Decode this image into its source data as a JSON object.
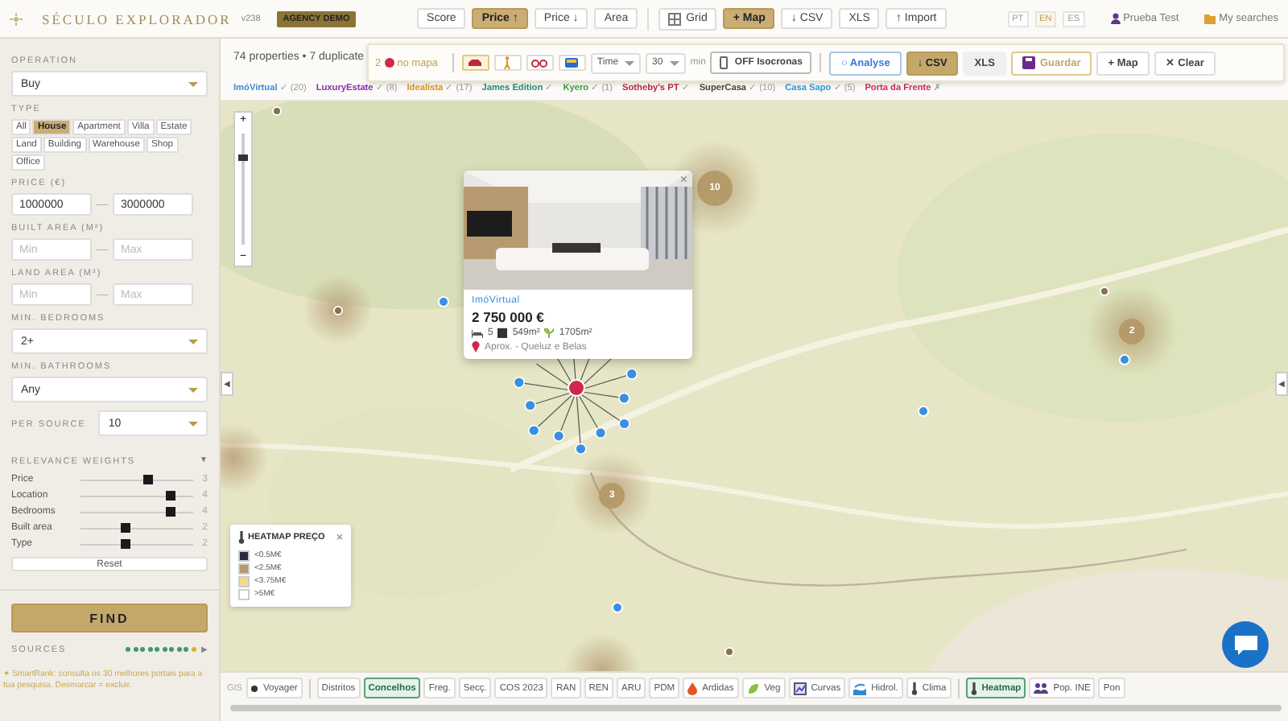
{
  "header": {
    "brand": "SÉCULO EXPLORADOR",
    "version": "v238",
    "badge": "AGENCY DEMO",
    "sort_buttons": [
      {
        "label": "Score",
        "selected": false
      },
      {
        "label": "Price ↑",
        "selected": true
      },
      {
        "label": "Price ↓",
        "selected": false
      },
      {
        "label": "Area",
        "selected": false
      }
    ],
    "view_buttons": [
      {
        "label": "Grid",
        "kind": "grid",
        "selected": false
      },
      {
        "label": "+ Map",
        "kind": "map",
        "selected": true
      }
    ],
    "export_buttons": [
      "↓ CSV",
      "XLS",
      "↑ Import"
    ],
    "languages": [
      {
        "label": "PT",
        "selected": false
      },
      {
        "label": "EN",
        "selected": true
      },
      {
        "label": "ES",
        "selected": false
      }
    ],
    "user": "Prueba Test",
    "saved_searches": "My searches"
  },
  "sidebar": {
    "operation": {
      "label": "OPERATION",
      "value": "Buy"
    },
    "type": {
      "label": "TYPE",
      "options": [
        {
          "label": "All",
          "selected": false
        },
        {
          "label": "House",
          "selected": true
        },
        {
          "label": "Apartment",
          "selected": false
        },
        {
          "label": "Villa",
          "selected": false
        },
        {
          "label": "Estate",
          "selected": false
        },
        {
          "label": "Land",
          "selected": false
        },
        {
          "label": "Building",
          "selected": false
        },
        {
          "label": "Warehouse",
          "selected": false
        },
        {
          "label": "Shop",
          "selected": false
        },
        {
          "label": "Office",
          "selected": false
        }
      ]
    },
    "ranges": [
      {
        "label": "PRICE (€)",
        "min": {
          "value": "1000000"
        },
        "max": {
          "value": "3000000"
        },
        "separator": "—"
      },
      {
        "label": "BUILT AREA (M²)",
        "min": {
          "placeholder": "Min"
        },
        "max": {
          "placeholder": "Max"
        },
        "separator": "—"
      },
      {
        "label": "LAND AREA (M²)",
        "min": {
          "placeholder": "Min"
        },
        "max": {
          "placeholder": "Max"
        },
        "separator": "—"
      }
    ],
    "selects": [
      {
        "label": "MIN. BEDROOMS",
        "value": "2+"
      },
      {
        "label": "MIN. BATHROOMS",
        "value": "Any"
      }
    ],
    "per_source": {
      "label": "PER SOURCE",
      "value": "10"
    },
    "weights": {
      "label": "RELEVANCE WEIGHTS",
      "toggle": "▼",
      "items": [
        {
          "name": "Price",
          "level": 0.6,
          "reading": "3"
        },
        {
          "name": "Location",
          "level": 0.8,
          "reading": "4"
        },
        {
          "name": "Bedrooms",
          "level": 0.8,
          "reading": "4"
        },
        {
          "name": "Built area",
          "level": 0.4,
          "reading": "2"
        },
        {
          "name": "Type",
          "level": 0.4,
          "reading": "2"
        }
      ],
      "reset": "Reset"
    },
    "find": "FIND",
    "sources": {
      "label": "SOURCES",
      "arrow": "▶",
      "dots": [
        {
          "color": "#3f9a6b"
        },
        {
          "color": "#3f9a6b"
        },
        {
          "color": "#3f9a6b"
        },
        {
          "color": "#3f9a6b"
        },
        {
          "color": "#3f9a6b"
        },
        {
          "color": "#3f9a6b"
        },
        {
          "color": "#3f9a6b"
        },
        {
          "color": "#3f9a6b"
        },
        {
          "color": "#3f9a6b"
        },
        {
          "color": "#e0b030"
        }
      ]
    },
    "note": "✦ SmartRank: consulta os 30 melhores portais para a tua pesquisa. Desmarcar = excluir."
  },
  "results": {
    "summary": "74 properties • 7 duplicate",
    "sources": [
      {
        "name": "ImóVirtual",
        "mark": "✓",
        "count": "(20)",
        "color": "#3a8fd8"
      },
      {
        "name": "LuxuryEstate",
        "mark": "✓",
        "count": "(8)",
        "color": "#8a2fb0"
      },
      {
        "name": "Idealista",
        "mark": "✓",
        "count": "(17)",
        "color": "#e0901a"
      },
      {
        "name": "James Edition",
        "mark": "✓",
        "color": "#2a8a70"
      },
      {
        "name": "Kyero",
        "mark": "✓",
        "count": "(1)",
        "color": "#3aa040"
      },
      {
        "name": "Sotheby's PT",
        "mark": "✓",
        "color": "#c0283a"
      },
      {
        "name": "SuperCasa",
        "mark": "✓",
        "count": "(10)",
        "color": "#4a4030"
      },
      {
        "name": "Casa Sapo",
        "mark": "✓",
        "count": "(5)",
        "color": "#2a9ad8"
      },
      {
        "name": "Porta da Frente",
        "mark": "✗",
        "color": "#d0285a"
      }
    ]
  },
  "map_toolbar": {
    "count": "2",
    "count_label": "no mapa",
    "modes": [
      {
        "kind": "car",
        "selected": true
      },
      {
        "kind": "walk",
        "selected": false
      },
      {
        "kind": "bike",
        "selected": false
      },
      {
        "kind": "transit",
        "selected": false
      }
    ],
    "metric": "Time",
    "minutes": "30",
    "unit": "min",
    "isochrone": {
      "state": "OFF",
      "label": "Isocronas"
    },
    "actions": [
      {
        "label": "○ Analyse",
        "kind": "outline"
      },
      {
        "label": "↓ CSV",
        "kind": "primary"
      },
      {
        "label": "XLS",
        "kind": "plain"
      },
      {
        "label": "Guardar",
        "kind": "save"
      },
      {
        "label": "+ Map",
        "kind": "outline"
      },
      {
        "label": "✕ Clear",
        "kind": "outline"
      }
    ]
  },
  "map": {
    "zoom": {
      "in": "+",
      "out": "−",
      "level": 0.75
    },
    "collapse_left": "◀",
    "collapse_right": "◀",
    "clusters": [
      {
        "count": "10"
      },
      {
        "count": "3"
      },
      {
        "count": "2"
      }
    ],
    "popup": {
      "close": "×",
      "source": "ImóVirtual",
      "price": "2 750 000 €",
      "bedrooms": "5",
      "built_area": "549m²",
      "land_area": "1705m²",
      "location": "Aprox. - Queluz e Belas"
    },
    "legend": {
      "title": "HEATMAP PREÇO",
      "close": "×",
      "items": [
        {
          "label": "<0.5M€",
          "color": "#2a2a3e"
        },
        {
          "label": "<2.5M€",
          "color": "#b49a68"
        },
        {
          "label": "<3.75M€",
          "color": "#f2dc8c"
        },
        {
          "label": ">5M€",
          "color": "#ffffff"
        }
      ]
    }
  },
  "layers": {
    "label": "GIS",
    "groups": [
      {
        "items": [
          {
            "label": "Voyager",
            "kind": "basemap",
            "selected": false
          }
        ]
      },
      {
        "items": [
          {
            "label": "Distritos",
            "kind": "plain",
            "selected": false
          },
          {
            "label": "Concelhos",
            "kind": "plain",
            "selected": true
          },
          {
            "label": "Freg.",
            "kind": "plain",
            "selected": false
          },
          {
            "label": "Secç.",
            "kind": "plain",
            "selected": false
          },
          {
            "label": "COS 2023",
            "kind": "plain",
            "selected": false
          },
          {
            "label": "RAN",
            "kind": "plain",
            "selected": false
          },
          {
            "label": "REN",
            "kind": "plain",
            "selected": false
          },
          {
            "label": "ARU",
            "kind": "plain",
            "selected": false
          },
          {
            "label": "PDM",
            "kind": "plain",
            "selected": false
          },
          {
            "label": "Ardidas",
            "kind": "fire",
            "selected": false
          },
          {
            "label": "Veg",
            "kind": "leaf",
            "selected": false
          },
          {
            "label": "Curvas",
            "kind": "chart",
            "selected": false
          },
          {
            "label": "Hidrol.",
            "kind": "water",
            "selected": false
          },
          {
            "label": "Clima",
            "kind": "thermo",
            "selected": false
          }
        ]
      },
      {
        "items": [
          {
            "label": "Heatmap",
            "kind": "thermo",
            "selected": true
          },
          {
            "label": "Pop. INE",
            "kind": "people",
            "selected": false
          },
          {
            "label": "Pon",
            "kind": "plain",
            "selected": false
          }
        ]
      }
    ]
  }
}
